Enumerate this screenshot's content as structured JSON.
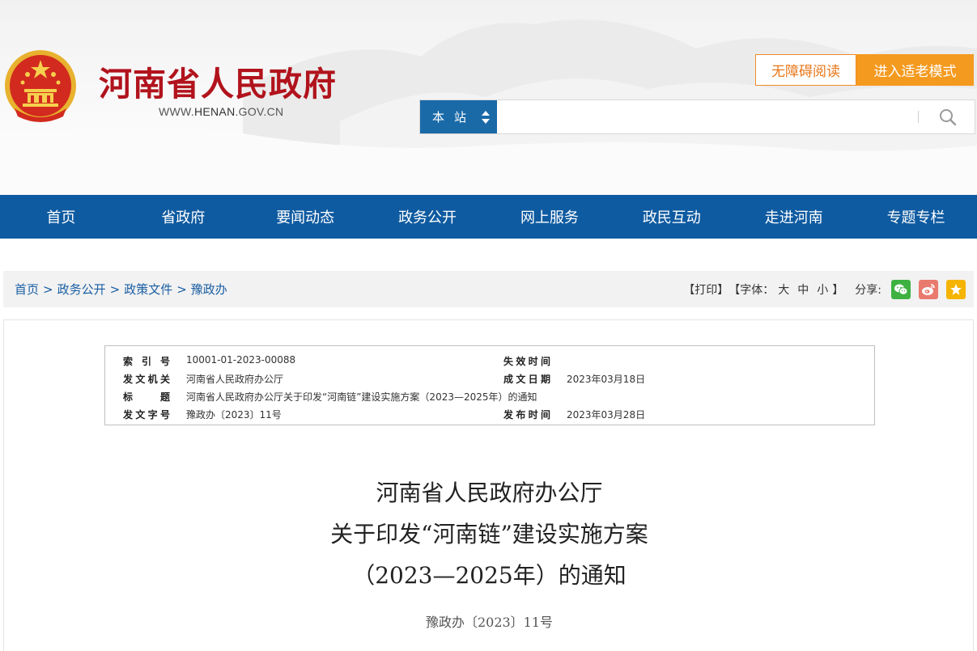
{
  "header": {
    "site_title": "河南省人民政府",
    "site_url_prefix": "WWW.",
    "site_url_main": "HENAN",
    "site_url_suffix": ".GOV.CN",
    "accessible_label": "无障碍阅读",
    "elder_mode_label": "进入适老模式",
    "search_scope": "本站",
    "search_placeholder": "",
    "accent_color": "#b1131c",
    "nav_color": "#0f5ba1",
    "orange_color": "#f49a1f"
  },
  "nav": {
    "items": [
      {
        "label": "首页"
      },
      {
        "label": "省政府"
      },
      {
        "label": "要闻动态"
      },
      {
        "label": "政务公开"
      },
      {
        "label": "网上服务"
      },
      {
        "label": "政民互动"
      },
      {
        "label": "走进河南"
      },
      {
        "label": "专题专栏"
      }
    ]
  },
  "breadcrumb": {
    "items": [
      "首页",
      "政务公开",
      "政策文件",
      "豫政办"
    ],
    "separator": ">"
  },
  "tools": {
    "print_label": "【打印】",
    "font_label": "【字体：",
    "font_large": "大",
    "font_medium": "中",
    "font_small": "小",
    "font_close": "】",
    "share_label": "分享:",
    "share_icons": [
      "wechat-icon",
      "weibo-icon",
      "favorite-icon"
    ]
  },
  "info": {
    "index_label": "索引号",
    "index_value": "10001-01-2023-00088",
    "expire_label": "失效时间",
    "expire_value": "",
    "issuer_label": "发文机关",
    "issuer_value": "河南省人民政府办公厅",
    "date_label": "成文日期",
    "date_value": "2023年03月18日",
    "title_label": "标题",
    "title_value": "河南省人民政府办公厅关于印发“河南链”建设实施方案（2023—2025年）的通知",
    "docno_label": "发文字号",
    "docno_value": "豫政办〔2023〕11号",
    "publish_label": "发布时间",
    "publish_value": "2023年03月28日"
  },
  "document": {
    "title_line1": "河南省人民政府办公厅",
    "title_line2": "关于印发“河南链”建设实施方案",
    "title_line3": "（2023—2025年）的通知",
    "number": "豫政办〔2023〕11号"
  }
}
